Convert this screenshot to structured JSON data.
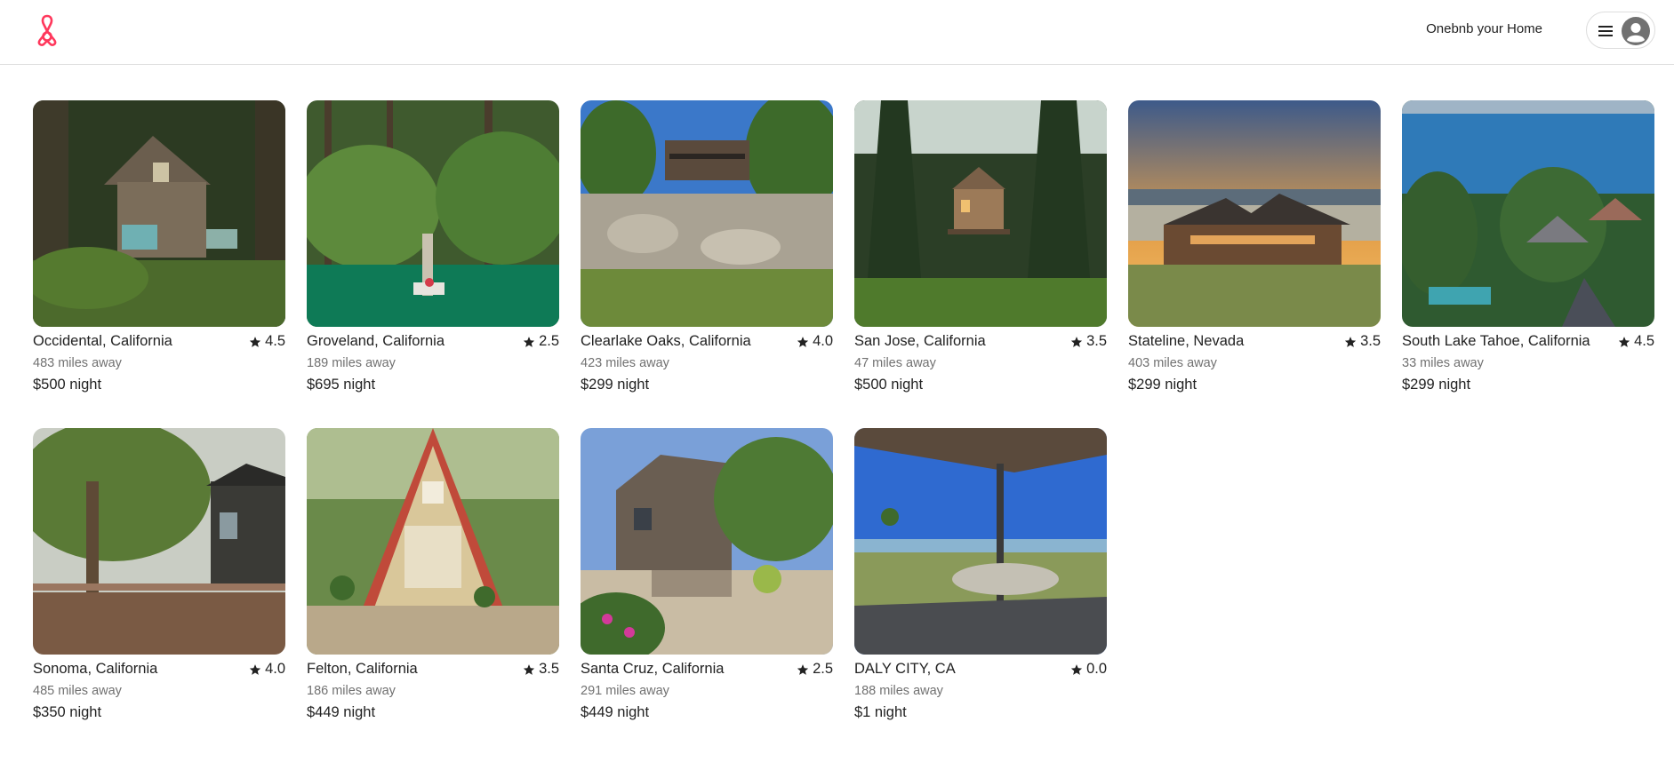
{
  "header": {
    "logo_icon": "airbnb-logo-icon",
    "brand_color": "#ff385c",
    "host_link": "Onebnb your Home",
    "menu_icon": "hamburger-icon",
    "avatar_icon": "user-avatar-icon"
  },
  "listings": [
    {
      "title": "Occidental, California",
      "rating": "4.5",
      "distance": "483 miles away",
      "price": "$500 night",
      "photo": "forest cabin"
    },
    {
      "title": "Groveland, California",
      "rating": "2.5",
      "distance": "189 miles away",
      "price": "$695 night",
      "photo": "lake with dock in forest"
    },
    {
      "title": "Clearlake Oaks, California",
      "rating": "4.0",
      "distance": "423 miles away",
      "price": "$299 night",
      "photo": "house on rocky lakeshore"
    },
    {
      "title": "San Jose, California",
      "rating": "3.5",
      "distance": "47 miles away",
      "price": "$500 night",
      "photo": "treehouse in pine forest"
    },
    {
      "title": "Stateline, Nevada",
      "rating": "3.5",
      "distance": "403 miles away",
      "price": "$299 night",
      "photo": "lodge at sunset"
    },
    {
      "title": "South Lake Tahoe, California",
      "rating": "4.5",
      "distance": "33 miles away",
      "price": "$299 night",
      "photo": "aerial lake view with homes"
    },
    {
      "title": "Sonoma, California",
      "rating": "4.0",
      "distance": "485 miles away",
      "price": "$350 night",
      "photo": "deck under oak tree"
    },
    {
      "title": "Felton, California",
      "rating": "3.5",
      "distance": "186 miles away",
      "price": "$449 night",
      "photo": "a-frame cabin with lights"
    },
    {
      "title": "Santa Cruz, California",
      "rating": "2.5",
      "distance": "291 miles away",
      "price": "$449 night",
      "photo": "wooden house with garden"
    },
    {
      "title": "DALY CITY, CA",
      "rating": "0.0",
      "distance": "188 miles away",
      "price": "$1 night",
      "photo": "patio with ocean view"
    }
  ]
}
